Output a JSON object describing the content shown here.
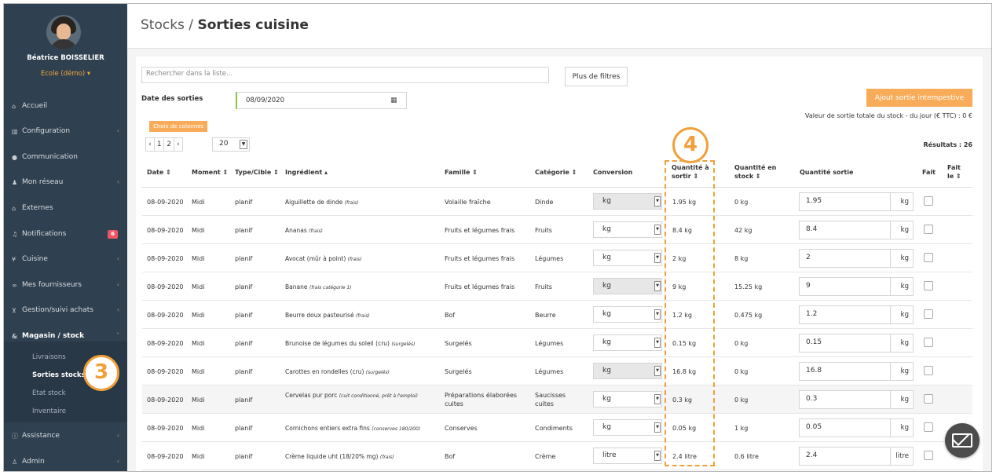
{
  "user": {
    "name": "Béatrice BOISSELIER",
    "school": "Ecole (démo) ▾"
  },
  "nav": [
    {
      "label": "Accueil",
      "icon": "home-icon",
      "chev": ""
    },
    {
      "label": "Configuration",
      "icon": "bank-icon",
      "chev": "‹"
    },
    {
      "label": "Communication",
      "icon": "comments-icon",
      "chev": ""
    },
    {
      "label": "Mon réseau",
      "icon": "users-icon",
      "chev": "‹"
    },
    {
      "label": "Externes",
      "icon": "home-icon",
      "chev": ""
    },
    {
      "label": "Notifications",
      "icon": "bell-icon",
      "badge": "6"
    },
    {
      "label": "Cuisine",
      "icon": "cutlery-icon",
      "chev": "‹"
    },
    {
      "label": "Mes fournisseurs",
      "icon": "handshake-icon",
      "chev": "‹"
    },
    {
      "label": "Gestion/suivi achats",
      "icon": "cart-icon",
      "chev": "‹"
    },
    {
      "label": "Magasin / stock",
      "icon": "cubes-icon",
      "chev": "˅"
    },
    {
      "label": "Assistance",
      "icon": "info-icon",
      "chev": "‹"
    },
    {
      "label": "Admin",
      "icon": "user-plus-icon",
      "chev": "‹"
    }
  ],
  "submenu": [
    "Livraisons",
    "Sorties stocks",
    "Etat stock",
    "Inventaire"
  ],
  "callouts": {
    "step3": "3",
    "step4": "4"
  },
  "page": {
    "title_prefix": "Stocks / ",
    "title_main": "Sorties cuisine"
  },
  "filters": {
    "search_placeholder": "Rechercher dans la liste...",
    "more_filters": "Plus de filtres",
    "date_label": "Date des sorties",
    "date_value": "08/09/2020",
    "columns_button": "Choix de colonnes",
    "pager": [
      "‹",
      "1",
      "2",
      "›"
    ],
    "page_size": "20",
    "add_button": "Ajout sortie intempestive",
    "total_value": "Valeur de sortie totale du stock - du jour (€ TTC) : 0 €",
    "results": "Résultats : 26"
  },
  "table": {
    "headers": {
      "date": "Date ⇕",
      "moment": "Moment ⇕",
      "type": "Type/Cible ⇕",
      "ingredient": "Ingrédient ▴",
      "famille": "Famille ⇕",
      "categorie": "Catégorie ⇕",
      "conversion": "Conversion",
      "qty_out_1": "Quantité à",
      "qty_out_2": "sortir ⇕",
      "qty_stock_1": "Quantité en",
      "qty_stock_2": "stock ⇕",
      "qty_sortie": "Quantité sortie",
      "fait": "Fait",
      "fait_le_1": "Fait",
      "fait_le_2": "le ⇕"
    },
    "rows": [
      {
        "date": "08-09-2020",
        "moment": "Midi",
        "type": "planif",
        "name": "Aiguillette de dinde",
        "note": "(frais)",
        "famille": "Volaille fraîche",
        "categorie": "Dinde",
        "conversion": "kg",
        "to_out": "1.95 kg",
        "stock": "0 kg",
        "sortie": "1.95",
        "unit": "kg"
      },
      {
        "date": "08-09-2020",
        "moment": "Midi",
        "type": "planif",
        "name": "Ananas",
        "note": "(frais)",
        "famille": "Fruits et légumes frais",
        "categorie": "Fruits",
        "conversion": "kg",
        "to_out": "8.4 kg",
        "stock": "42 kg",
        "sortie": "8.4",
        "unit": "kg"
      },
      {
        "date": "08-09-2020",
        "moment": "Midi",
        "type": "planif",
        "name": "Avocat (mûr à point)",
        "note": "(frais)",
        "famille": "Fruits et légumes frais",
        "categorie": "Légumes",
        "conversion": "kg",
        "to_out": "2 kg",
        "stock": "8 kg",
        "sortie": "2",
        "unit": "kg"
      },
      {
        "date": "08-09-2020",
        "moment": "Midi",
        "type": "planif",
        "name": "Banane",
        "note": "(frais catégorie 1)",
        "famille": "Fruits et légumes frais",
        "categorie": "Fruits",
        "conversion": "kg",
        "to_out": "9 kg",
        "stock": "15.25 kg",
        "sortie": "9",
        "unit": "kg"
      },
      {
        "date": "08-09-2020",
        "moment": "Midi",
        "type": "planif",
        "name": "Beurre doux pasteurisé",
        "note": "(frais)",
        "famille": "Bof",
        "categorie": "Beurre",
        "conversion": "kg",
        "to_out": "1.2 kg",
        "stock": "0.475 kg",
        "sortie": "1.2",
        "unit": "kg"
      },
      {
        "date": "08-09-2020",
        "moment": "Midi",
        "type": "planif",
        "name": "Brunoise de légumes du soleil (cru)",
        "note": "(surgelés)",
        "famille": "Surgelés",
        "categorie": "Légumes",
        "conversion": "kg",
        "to_out": "0.15 kg",
        "stock": "0 kg",
        "sortie": "0.15",
        "unit": "kg"
      },
      {
        "date": "08-09-2020",
        "moment": "Midi",
        "type": "planif",
        "name": "Carottes en rondelles (cru)",
        "note": "(surgelés)",
        "famille": "Surgelés",
        "categorie": "Légumes",
        "conversion": "kg",
        "to_out": "16.8 kg",
        "stock": "0 kg",
        "sortie": "16.8",
        "unit": "kg"
      },
      {
        "date": "08-09-2020",
        "moment": "Midi",
        "type": "planif",
        "name": "Cervelas pur porc",
        "note": "(cuit conditionné, prêt à l'emploi)",
        "famille": "Préparations élaborées cuites",
        "categorie": "Saucisses cuites",
        "conversion": "kg",
        "to_out": "0.3 kg",
        "stock": "0 kg",
        "sortie": "0.3",
        "unit": "kg"
      },
      {
        "date": "08-09-2020",
        "moment": "Midi",
        "type": "planif",
        "name": "Cornichons entiers extra fins",
        "note": "(conserves 180/200)",
        "famille": "Conserves",
        "categorie": "Condiments",
        "conversion": "kg",
        "to_out": "0.05 kg",
        "stock": "1 kg",
        "sortie": "0.05",
        "unit": "kg"
      },
      {
        "date": "08-09-2020",
        "moment": "Midi",
        "type": "planif",
        "name": "Crème liquide uht (18/20% mg)",
        "note": "(frais)",
        "famille": "Bof",
        "categorie": "Crème",
        "conversion": "litre",
        "to_out": "2.4 litre",
        "stock": "0.6 litre",
        "sortie": "2.4",
        "unit": "litre"
      }
    ]
  }
}
